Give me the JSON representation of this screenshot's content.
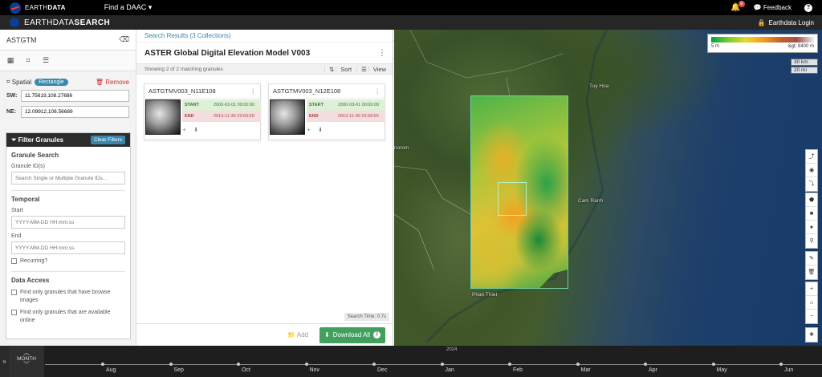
{
  "topbar": {
    "brand_light": "EARTH",
    "brand_bold": "DATA",
    "find_daac": "Find a DAAC ▾",
    "notification_count": "6",
    "feedback": "Feedback",
    "help": "?"
  },
  "subbar": {
    "title_light": "EARTHDATA",
    "title_bold": "SEARCH",
    "login": "Earthdata Login"
  },
  "search": {
    "value": "ASTGTM"
  },
  "spatial": {
    "label": "Spatial",
    "type": "Rectangle",
    "remove": "Remove",
    "sw_label": "SW:",
    "sw_value": "11.75619,108.27686",
    "ne_label": "NE:",
    "ne_value": "12.09912,108.56689"
  },
  "filter": {
    "title": "Filter Granules",
    "clear": "Clear Filters",
    "granule_search": "Granule Search",
    "granule_ids_label": "Granule ID(s)",
    "granule_ids_placeholder": "Search Single or Multiple Granule IDs...",
    "temporal": "Temporal",
    "start_label": "Start",
    "start_placeholder": "YYYY-MM-DD HH:mm:ss",
    "end_label": "End",
    "end_placeholder": "YYYY-MM-DD HH:mm:ss",
    "recurring": "Recurring?",
    "data_access": "Data Access",
    "browse_only": "Find only granules that have browse images",
    "online_only": "Find only granules that are available online"
  },
  "results": {
    "breadcrumb": "Search Results (3 Collections)",
    "collection_title": "ASTER Global Digital Elevation Model V003",
    "showing": "Showing 2 of 2 matching granules",
    "sort": "Sort",
    "view": "View",
    "granules": [
      {
        "id": "ASTGTMV003_N11E108",
        "start_label": "START",
        "start": "2000-03-01 00:00:00",
        "end_label": "END",
        "end": "2013-11-30 23:59:59"
      },
      {
        "id": "ASTGTMV003_N12E108",
        "start_label": "START",
        "start": "2000-03-01 00:00:00",
        "end_label": "END",
        "end": "2013-11-30 23:59:59"
      }
    ],
    "search_time": "Search Time: 0.7s",
    "add": "Add",
    "download_all": "Download All",
    "download_count": "2"
  },
  "map": {
    "legend_min": "5 m",
    "legend_max": "&gt; 8400 m",
    "scale_km": "30 km",
    "scale_mi": "20 mi",
    "places": {
      "tuy_hoa": "Tuy Hoa",
      "cam_ranh": "Cam Ranh",
      "phan_thiet": "Phan Thiet",
      "norom": "norom"
    }
  },
  "timeline": {
    "interval": "MONTH",
    "year": "2024",
    "months": [
      "Aug",
      "Sep",
      "Oct",
      "Nov",
      "Dec",
      "Jan",
      "Feb",
      "Mar",
      "Apr",
      "May",
      "Jun"
    ]
  },
  "icons": {
    "eraser": "eraser-icon",
    "calendar": "calendar-icon",
    "crop": "crop-icon",
    "list": "list-icon",
    "bell": "bell-icon",
    "comment": "comment-icon",
    "lock": "lock-icon",
    "filter": "filter-icon",
    "trash": "trash-icon",
    "plus": "plus-icon",
    "download": "download-icon"
  },
  "colors": {
    "accent": "#3a87ad",
    "download": "#42a05e",
    "remove": "#c9302c",
    "start": "#3c763d",
    "end": "#a94442"
  }
}
